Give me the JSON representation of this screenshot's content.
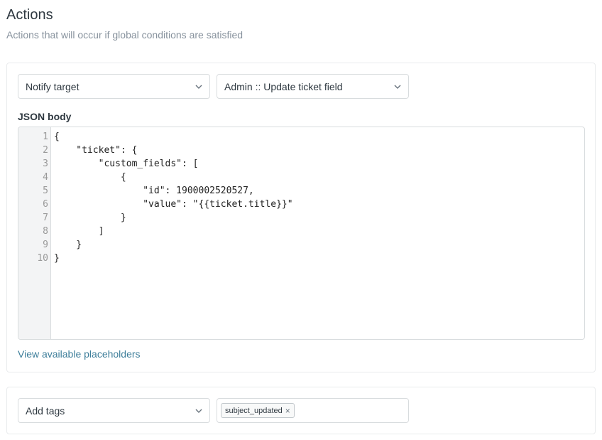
{
  "header": {
    "title": "Actions",
    "subtitle": "Actions that will occur if global conditions are satisfied"
  },
  "action1": {
    "type_select": {
      "value": "Notify target",
      "icon": "chevron-down-icon"
    },
    "target_select": {
      "value": "Admin :: Update ticket field",
      "icon": "chevron-down-icon"
    },
    "json_label": "JSON body",
    "editor": {
      "line_numbers": [
        "1",
        "2",
        "3",
        "4",
        "5",
        "6",
        "7",
        "8",
        "9",
        "10"
      ],
      "lines": [
        "{",
        "    \"ticket\": {",
        "        \"custom_fields\": [",
        "            {",
        "                \"id\": 1900002520527,",
        "                \"value\": \"{{ticket.title}}\"",
        "            }",
        "        ]",
        "    }",
        "}"
      ]
    },
    "placeholders_link": "View available placeholders"
  },
  "action2": {
    "type_select": {
      "value": "Add tags",
      "icon": "chevron-down-icon"
    },
    "tags": [
      {
        "label": "subject_updated",
        "remove_icon": "close-icon",
        "remove_glyph": "×"
      }
    ]
  },
  "colors": {
    "text": "#2f3941",
    "muted": "#87929d",
    "border": "#d8dcde",
    "link": "#3d7e9a",
    "gutter_bg": "#f3f4f5"
  }
}
